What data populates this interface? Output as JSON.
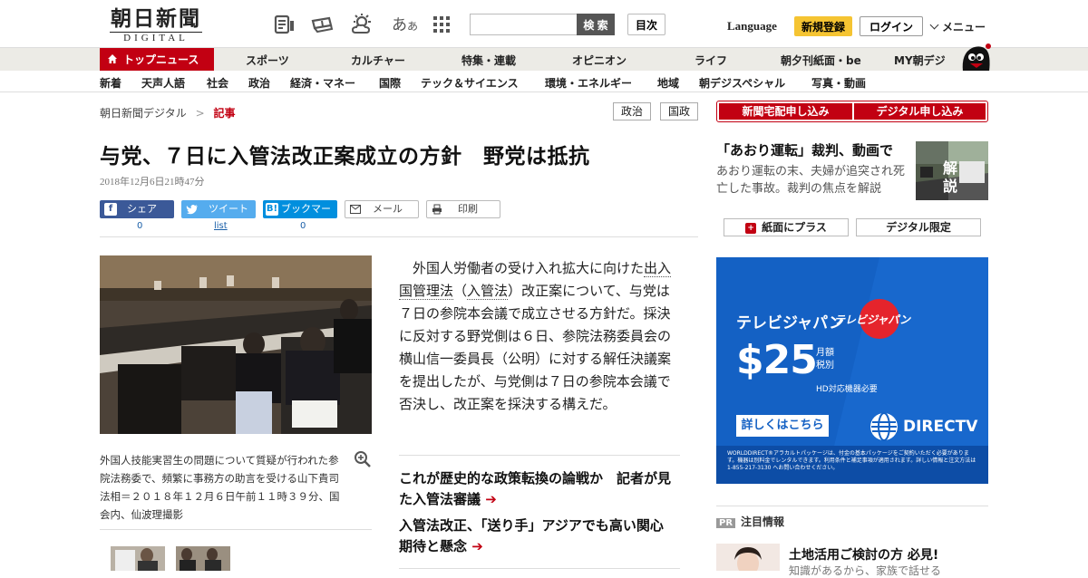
{
  "header": {
    "logo_kanji": "朝日新聞",
    "logo_sub": "DIGITAL",
    "search_button": "検 索",
    "toc_button": "目次",
    "language": "Language",
    "register": "新規登録",
    "login": "ログイン",
    "menu": "メニュー",
    "icons": [
      "newspaper-icon",
      "ticket-icon",
      "weather-icon",
      "font-size-icon",
      "grid-icon"
    ],
    "font_size_glyph": "あ",
    "font_size_glyph_small": "あ"
  },
  "nav_primary": [
    "トップニュース",
    "スポーツ",
    "カルチャー",
    "特集・連載",
    "オピニオン",
    "ライフ",
    "朝夕刊紙面・be",
    "MY朝デジ"
  ],
  "nav_secondary": [
    "新着",
    "天声人語",
    "社会",
    "政治",
    "経済・マネー",
    "国際",
    "テック＆サイエンス",
    "環境・エネルギー",
    "地域",
    "朝デジスペシャル",
    "写真・動画"
  ],
  "breadcrumb": {
    "home": "朝日新聞デジタル",
    "sep": ">",
    "current": "記事"
  },
  "tags": [
    "政治",
    "国政"
  ],
  "article": {
    "title": "与党、７日に入管法改正案成立の方針　野党は抵抗",
    "date": "2018年12月6日21時47分",
    "body_before": "外国人労働者の受け入れ拡大に向けた",
    "link1": "出入国管理法",
    "paren_open": "（",
    "link2": "入管法",
    "paren_close": "）",
    "body_after": "改正案について、与党は７日の参院本会議で成立させる方針だ。採決に反対する野党側は６日、参院法務委員会の横山信一委員長（公明）に対する解任決議案を提出したが、与党側は７日の参院本会議で否決し、改正案を採決する構えだ。",
    "caption": "外国人技能実習生の問題について質疑が行われた参院法務委で、頻繁に事務方の助言を受ける山下貴司法相＝２０１８年１２月６日午前１１時３９分、国会内、仙波理撮影"
  },
  "share": {
    "facebook": {
      "label": "シェア",
      "count": "0"
    },
    "twitter": {
      "label": "ツイート",
      "count": "list"
    },
    "hatena": {
      "label": "ブックマーク",
      "count": "0"
    },
    "mail": "メール",
    "print": "印刷"
  },
  "related": [
    "これが歴史的な政策転換の論戦か　記者が見た入管法審議",
    "入管法改正、「送り手」アジアでも高い関心　期待と懸念"
  ],
  "sidebar": {
    "subscribe_paper": "新聞宅配申し込み",
    "subscribe_digital": "デジタル申し込み",
    "promo_title": "「あおり運転」裁判、動画で",
    "promo_desc": "あおり運転の末、夫婦が追突され死亡した事故。裁判の焦点を解説",
    "promo_badge": "解説",
    "plus_paper": "紙面にプラス",
    "digital_only": "デジタル限定",
    "ad": {
      "brand": "テレビジャパン",
      "logo": "テレビジャパン",
      "price": "$25",
      "price_note1": "月額",
      "price_note2": "税別",
      "hd": "HD対応機器必要",
      "cta": "詳しくはこちら",
      "provider": "DIRECTV",
      "fine_print": "WORLDDIRECT®アラカルトパッケージは、付金の基本パッケージをご契約いただく必要があります。機器は別料金でレンタルできます。利用条件と補足事項が適用されます。詳しい情報と注文方法は 1-855-217-3130 へお問い合わせください。"
    },
    "pr_label": "PR",
    "pr_head": "注目情報",
    "pr_title": "土地活用ご検討の方 必見!",
    "pr_sub": "知識があるから、家族で話せる"
  },
  "colors": {
    "accent": "#c20012",
    "facebook": "#3b5998",
    "twitter": "#55acee",
    "hatena": "#008fde",
    "register": "#f5c432",
    "ad_bg": "#1461c4"
  }
}
